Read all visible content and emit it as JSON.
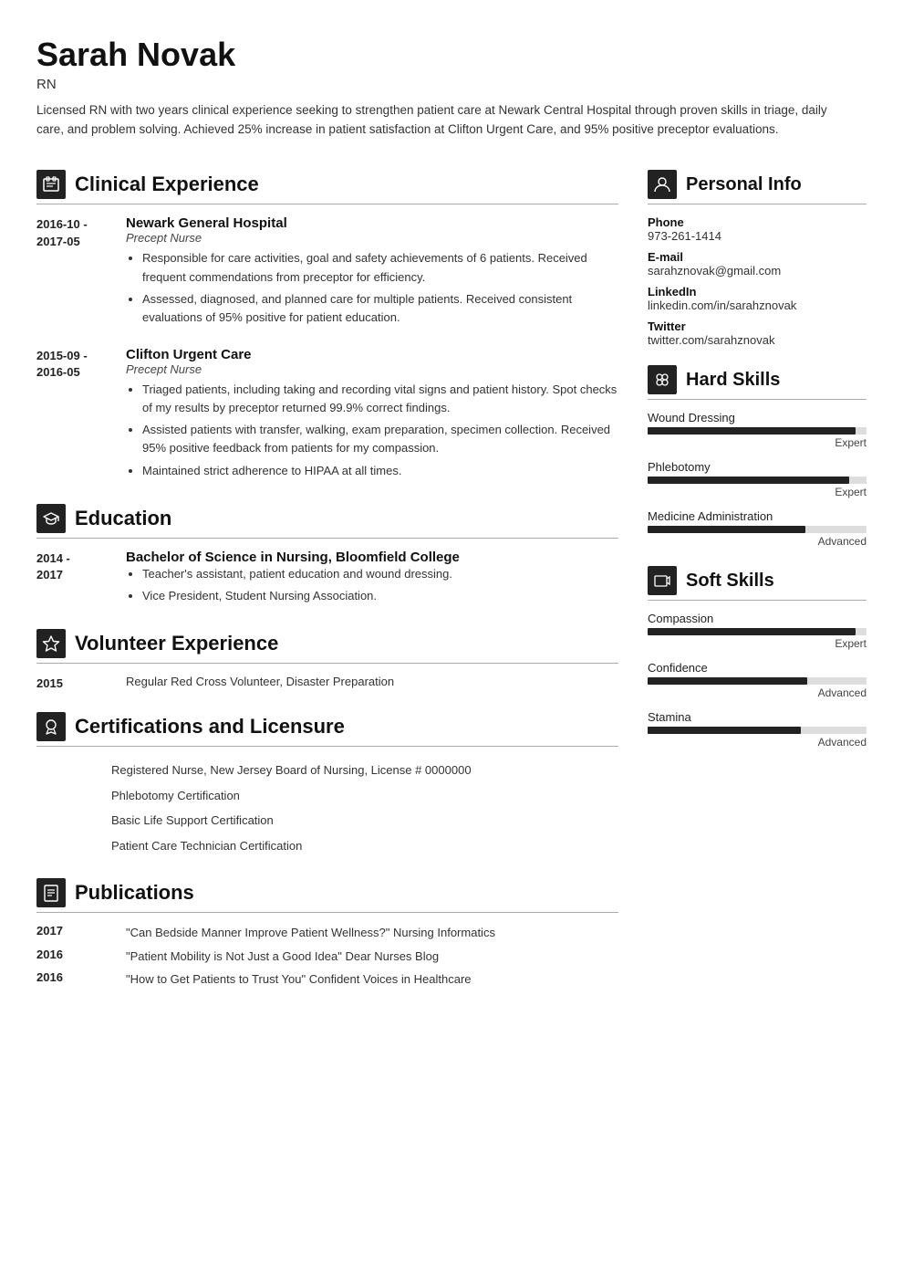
{
  "header": {
    "name": "Sarah Novak",
    "title": "RN",
    "summary": "Licensed RN with two years clinical experience seeking to strengthen patient care at Newark Central Hospital through proven skills in triage, daily care, and problem solving. Achieved 25% increase in patient satisfaction at Clifton Urgent Care, and 95% positive preceptor evaluations."
  },
  "sections": {
    "clinical_experience": {
      "title": "Clinical Experience",
      "entries": [
        {
          "date": "2016-10 -\n2017-05",
          "employer": "Newark General Hospital",
          "role": "Precept Nurse",
          "bullets": [
            "Responsible for care activities, goal and safety achievements of 6 patients. Received frequent commendations from preceptor for efficiency.",
            "Assessed, diagnosed, and planned care for multiple patients. Received consistent evaluations of 95% positive for patient education."
          ]
        },
        {
          "date": "2015-09 -\n2016-05",
          "employer": "Clifton Urgent Care",
          "role": "Precept Nurse",
          "bullets": [
            "Triaged patients, including taking and recording vital signs and patient history. Spot checks of my results by preceptor returned 99.9% correct findings.",
            "Assisted patients with transfer, walking, exam preparation, specimen collection. Received 95% positive feedback from patients for my compassion.",
            "Maintained strict adherence to HIPAA at all times."
          ]
        }
      ]
    },
    "education": {
      "title": "Education",
      "entries": [
        {
          "date": "2014 -\n2017",
          "degree": "Bachelor of Science in Nursing, Bloomfield College",
          "bullets": [
            "Teacher's assistant, patient education and wound dressing.",
            "Vice President, Student Nursing Association."
          ]
        }
      ]
    },
    "volunteer": {
      "title": "Volunteer Experience",
      "entries": [
        {
          "date": "2015",
          "description": "Regular Red Cross Volunteer, Disaster Preparation"
        }
      ]
    },
    "certifications": {
      "title": "Certifications and Licensure",
      "entries": [
        "Registered Nurse, New Jersey Board of Nursing, License # 0000000",
        "Phlebotomy Certification",
        "Basic Life Support Certification",
        "Patient Care Technician Certification"
      ]
    },
    "publications": {
      "title": "Publications",
      "entries": [
        {
          "date": "2017",
          "text": "\"Can Bedside Manner Improve Patient Wellness?\" Nursing Informatics"
        },
        {
          "date": "2016",
          "text": "\"Patient Mobility is Not Just a Good Idea\" Dear Nurses Blog"
        },
        {
          "date": "2016",
          "text": "\"How to Get Patients to Trust You\" Confident Voices in Healthcare"
        }
      ]
    }
  },
  "right": {
    "personal_info": {
      "title": "Personal Info",
      "items": [
        {
          "label": "Phone",
          "value": "973-261-1414"
        },
        {
          "label": "E-mail",
          "value": "sarahznovak@gmail.com"
        },
        {
          "label": "LinkedIn",
          "value": "linkedin.com/in/sarahznovak"
        },
        {
          "label": "Twitter",
          "value": "twitter.com/sarahznovak"
        }
      ]
    },
    "hard_skills": {
      "title": "Hard Skills",
      "items": [
        {
          "name": "Wound Dressing",
          "level": "Expert",
          "pct": 95
        },
        {
          "name": "Phlebotomy",
          "level": "Expert",
          "pct": 92
        },
        {
          "name": "Medicine Administration",
          "level": "Advanced",
          "pct": 72
        }
      ]
    },
    "soft_skills": {
      "title": "Soft Skills",
      "items": [
        {
          "name": "Compassion",
          "level": "Expert",
          "pct": 95
        },
        {
          "name": "Confidence",
          "level": "Advanced",
          "pct": 73
        },
        {
          "name": "Stamina",
          "level": "Advanced",
          "pct": 70
        }
      ]
    }
  },
  "icons": {
    "clinical": "🗂",
    "education": "🎓",
    "volunteer": "⭐",
    "certifications": "🏅",
    "publications": "📋",
    "personal": "👤",
    "hard_skills": "🔧",
    "soft_skills": "🚩"
  }
}
